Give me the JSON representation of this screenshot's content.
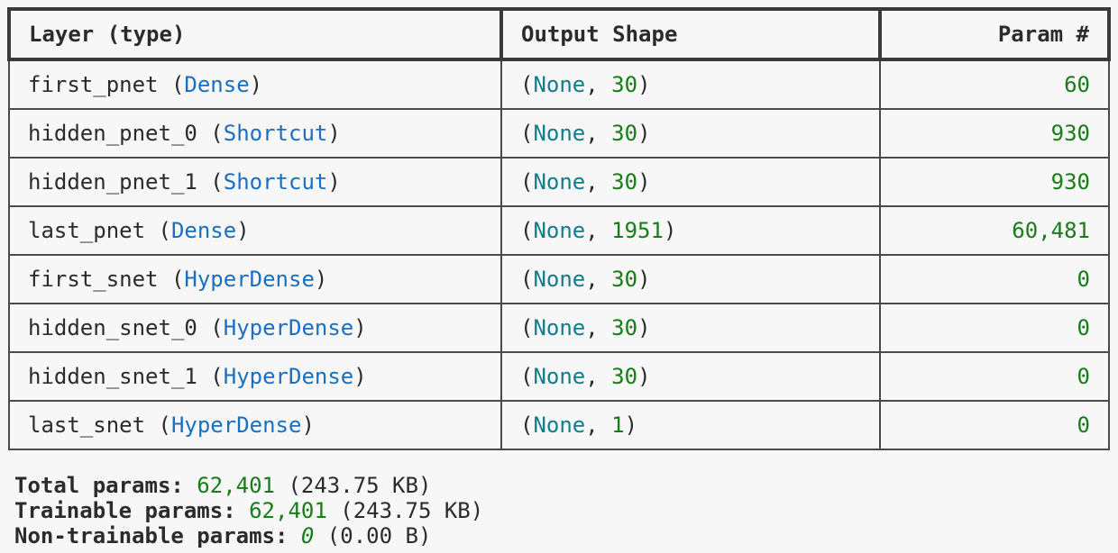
{
  "header": {
    "layer": "Layer (type)",
    "output_shape": "Output Shape",
    "param": "Param #"
  },
  "rows": [
    {
      "name": "first_pnet",
      "type": "Dense",
      "none": "None",
      "dim": "30",
      "params": "60"
    },
    {
      "name": "hidden_pnet_0",
      "type": "Shortcut",
      "none": "None",
      "dim": "30",
      "params": "930"
    },
    {
      "name": "hidden_pnet_1",
      "type": "Shortcut",
      "none": "None",
      "dim": "30",
      "params": "930"
    },
    {
      "name": "last_pnet",
      "type": "Dense",
      "none": "None",
      "dim": "1951",
      "params": "60,481"
    },
    {
      "name": "first_snet",
      "type": "HyperDense",
      "none": "None",
      "dim": "30",
      "params": "0"
    },
    {
      "name": "hidden_snet_0",
      "type": "HyperDense",
      "none": "None",
      "dim": "30",
      "params": "0"
    },
    {
      "name": "hidden_snet_1",
      "type": "HyperDense",
      "none": "None",
      "dim": "30",
      "params": "0"
    },
    {
      "name": "last_snet",
      "type": "HyperDense",
      "none": "None",
      "dim": "1",
      "params": "0"
    }
  ],
  "totals": {
    "total": {
      "label": "Total params:",
      "value": "62,401",
      "size": "(243.75 KB)"
    },
    "trainable": {
      "label": "Trainable params:",
      "value": "62,401",
      "size": "(243.75 KB)"
    },
    "non_trainable": {
      "label": "Non-trainable params:",
      "value": "0",
      "size": "(0.00 B)"
    }
  }
}
